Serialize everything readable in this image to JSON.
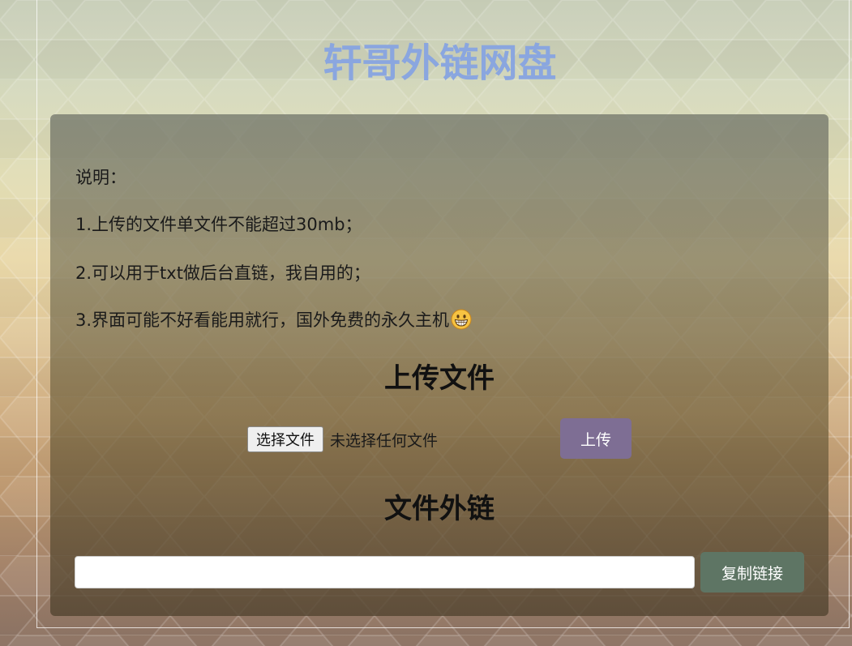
{
  "header": {
    "title": "轩哥外链网盘",
    "title_color": "#8aa6df"
  },
  "instructions": {
    "heading": "说明：",
    "items": [
      "1.上传的文件单文件不能超过30mb；",
      "2.可以用于txt做后台直链，我自用的；",
      "3.界面可能不好看能用就行，国外免费的永久主机"
    ],
    "trailing_icon": "grinning-face-emoji"
  },
  "upload": {
    "section_title": "上传文件",
    "choose_button_label": "选择文件",
    "file_status": "未选择任何文件",
    "upload_button_label": "上传",
    "upload_button_color": "#7e6e94"
  },
  "link": {
    "section_title": "文件外链",
    "input_value": "",
    "copy_button_label": "复制链接",
    "copy_button_color": "#5e7564"
  }
}
